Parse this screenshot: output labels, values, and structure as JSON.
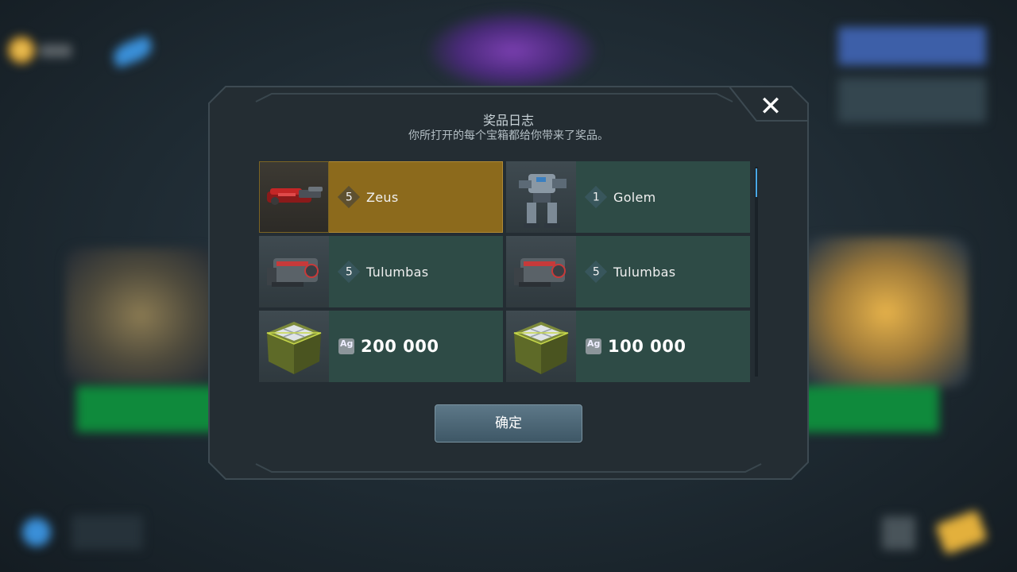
{
  "dialog": {
    "title": "奖品日志",
    "subtitle": "你所打开的每个宝箱都给你带来了奖品。",
    "close_icon": "✕",
    "confirm_label": "确定"
  },
  "rewards": [
    {
      "type": "weapon",
      "count": "5",
      "name": "Zeus",
      "icon": "zeus-weapon-icon",
      "highlighted": true
    },
    {
      "type": "robot",
      "count": "1",
      "name": "Golem",
      "icon": "golem-robot-icon",
      "highlighted": false
    },
    {
      "type": "weapon",
      "count": "5",
      "name": "Tulumbas",
      "icon": "tulumbas-weapon-icon",
      "highlighted": false
    },
    {
      "type": "weapon",
      "count": "5",
      "name": "Tulumbas",
      "icon": "tulumbas-weapon-icon",
      "highlighted": false
    },
    {
      "type": "silver",
      "currency": "Ag",
      "amount": "200 000",
      "icon": "silver-crate-icon",
      "highlighted": false
    },
    {
      "type": "silver",
      "currency": "Ag",
      "amount": "100 000",
      "icon": "silver-crate-icon",
      "highlighted": false
    }
  ],
  "colors": {
    "highlight": "#8c6a1c",
    "tile": "#2e4b46",
    "dialog_bg": "#242d33",
    "scroll_thumb": "#4aa8e6"
  }
}
